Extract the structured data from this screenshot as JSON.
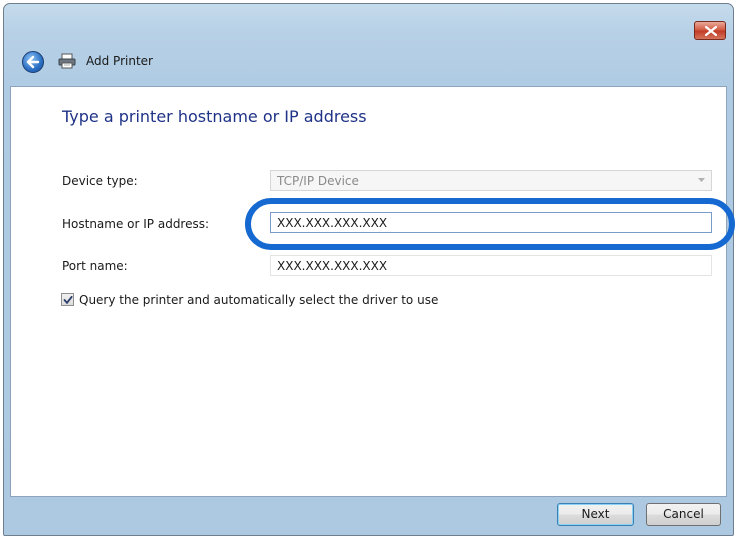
{
  "window": {
    "title": "Add Printer"
  },
  "main": {
    "heading": "Type a printer hostname or IP address",
    "device_type": {
      "label": "Device type:",
      "value": "TCP/IP Device"
    },
    "hostname": {
      "label": "Hostname or IP address:",
      "value": "XXX.XXX.XXX.XXX"
    },
    "port": {
      "label": "Port name:",
      "value": "XXX.XXX.XXX.XXX"
    },
    "query_checkbox": {
      "label": "Query the printer and automatically select the driver to use",
      "checked": true
    }
  },
  "footer": {
    "next_label": "Next",
    "cancel_label": "Cancel"
  },
  "colors": {
    "highlight": "#1569d1",
    "heading": "#1e3287",
    "close": "#c03a24"
  },
  "icons": [
    "close-icon",
    "back-arrow-icon",
    "printer-icon",
    "chevron-down-icon",
    "checkmark-icon"
  ]
}
